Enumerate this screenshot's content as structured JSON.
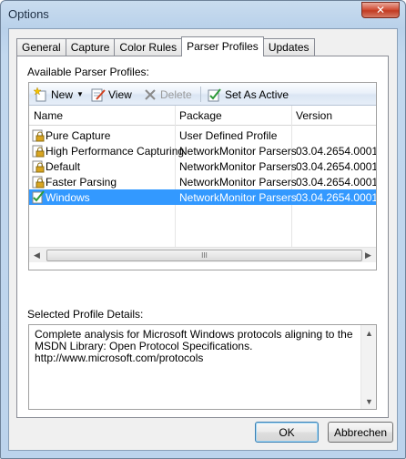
{
  "window": {
    "title": "Options",
    "close_glyph": "✕"
  },
  "tabs": [
    {
      "label": "General",
      "active": false
    },
    {
      "label": "Capture",
      "active": false
    },
    {
      "label": "Color Rules",
      "active": false
    },
    {
      "label": "Parser Profiles",
      "active": true
    },
    {
      "label": "Updates",
      "active": false
    }
  ],
  "profiles": {
    "section_label": "Available Parser Profiles:",
    "toolbar": {
      "new_label": "New",
      "view_label": "View",
      "delete_label": "Delete",
      "set_active_label": "Set As Active"
    },
    "columns": [
      "Name",
      "Package",
      "Version"
    ],
    "rows": [
      {
        "name": "Pure Capture",
        "package": "User Defined Profile",
        "version": "",
        "icon": "lock-icon",
        "selected": false
      },
      {
        "name": "High Performance Capturing",
        "package": "NetworkMonitor Parsers",
        "version": "03.04.2654.0001",
        "icon": "lock-icon",
        "selected": false
      },
      {
        "name": "Default",
        "package": "NetworkMonitor Parsers",
        "version": "03.04.2654.0001",
        "icon": "lock-icon",
        "selected": false
      },
      {
        "name": "Faster Parsing",
        "package": "NetworkMonitor Parsers",
        "version": "03.04.2654.0001",
        "icon": "lock-icon",
        "selected": false
      },
      {
        "name": "Windows",
        "package": "NetworkMonitor Parsers",
        "version": "03.04.2654.0001",
        "icon": "active-check-icon",
        "selected": true
      }
    ],
    "scroll_grip": "III"
  },
  "details": {
    "section_label": "Selected Profile Details:",
    "text": "Complete analysis for Microsoft Windows protocols aligning to the MSDN Library: Open Protocol Specifications.\nhttp://www.microsoft.com/protocols"
  },
  "buttons": {
    "ok_label": "OK",
    "cancel_label": "Abbrechen"
  },
  "colors": {
    "selection": "#3399ff",
    "window_frame": "#b9d1ea"
  }
}
